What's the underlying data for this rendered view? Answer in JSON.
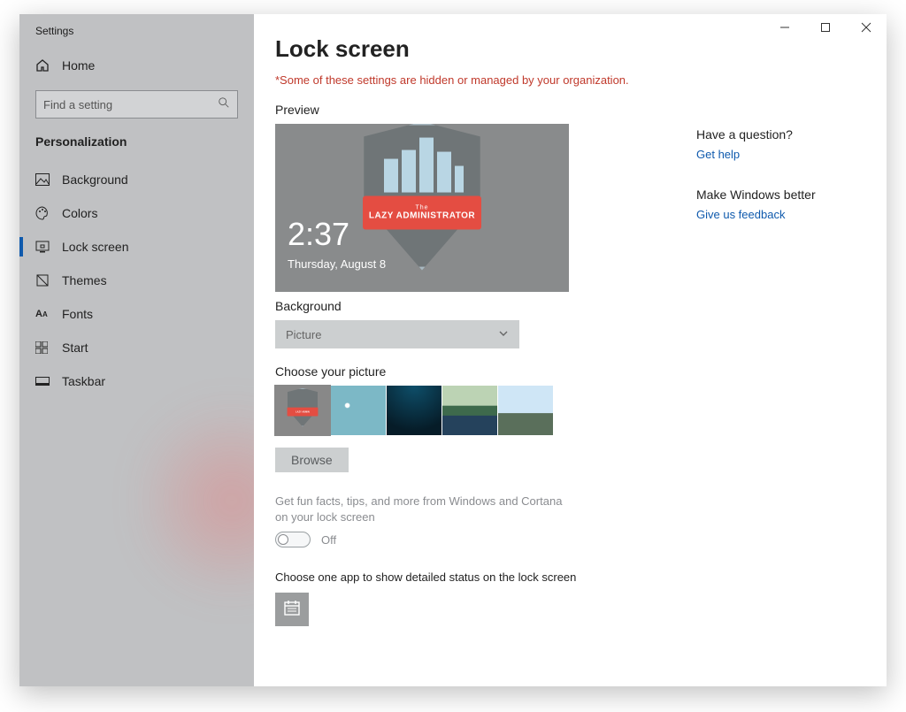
{
  "window": {
    "title": "Settings"
  },
  "sidebar": {
    "home_label": "Home",
    "search_placeholder": "Find a setting",
    "category": "Personalization",
    "items": [
      {
        "label": "Background"
      },
      {
        "label": "Colors"
      },
      {
        "label": "Lock screen"
      },
      {
        "label": "Themes"
      },
      {
        "label": "Fonts"
      },
      {
        "label": "Start"
      },
      {
        "label": "Taskbar"
      }
    ]
  },
  "main": {
    "title": "Lock screen",
    "warning": "*Some of these settings are hidden or managed by your organization.",
    "preview_label": "Preview",
    "preview_time": "2:37",
    "preview_date": "Thursday, August 8",
    "badge_top": "The",
    "badge_text": "LAZY ADMINISTRATOR",
    "background_label": "Background",
    "background_value": "Picture",
    "choose_picture_label": "Choose your picture",
    "browse_label": "Browse",
    "fun_facts_hint": "Get fun facts, tips, and more from Windows and Cortana on your lock screen",
    "fun_facts_state": "Off",
    "detailed_status_label": "Choose one app to show detailed status on the lock screen"
  },
  "right": {
    "question_heading": "Have a question?",
    "help_link": "Get help",
    "improve_heading": "Make Windows better",
    "feedback_link": "Give us feedback"
  }
}
